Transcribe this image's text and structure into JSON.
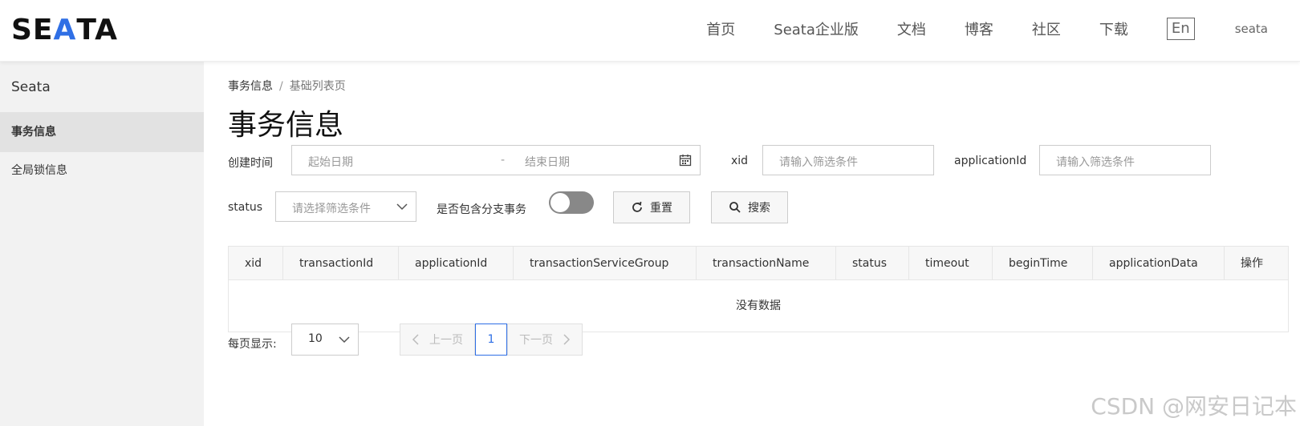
{
  "header": {
    "logo_pre": "SE",
    "logo_accent": "A",
    "logo_post": "TA",
    "nav": [
      "首页",
      "Seata企业版",
      "文档",
      "博客",
      "社区",
      "下载"
    ],
    "lang": "En",
    "user": "seata"
  },
  "sidebar": {
    "title": "Seata",
    "items": [
      {
        "label": "事务信息",
        "active": true
      },
      {
        "label": "全局锁信息",
        "active": false
      }
    ]
  },
  "breadcrumb": {
    "parent": "事务信息",
    "sep": "/",
    "current": "基础列表页"
  },
  "page_title": "事务信息",
  "filters": {
    "create_time_label": "创建时间",
    "start_placeholder": "起始日期",
    "range_sep": "-",
    "end_placeholder": "结束日期",
    "xid_label": "xid",
    "xid_placeholder": "请输入筛选条件",
    "app_label": "applicationId",
    "app_placeholder": "请输入筛选条件",
    "status_label": "status",
    "status_placeholder": "请选择筛选条件",
    "branch_label": "是否包含分支事务",
    "branch_on": false,
    "reset_label": "重置",
    "search_label": "搜索"
  },
  "table": {
    "columns": [
      "xid",
      "transactionId",
      "applicationId",
      "transactionServiceGroup",
      "transactionName",
      "status",
      "timeout",
      "beginTime",
      "applicationData",
      "操作"
    ],
    "empty_text": "没有数据"
  },
  "pagination": {
    "page_size_label": "每页显示:",
    "page_size": "10",
    "prev_label": "上一页",
    "current_page": "1",
    "next_label": "下一页"
  },
  "watermark": "CSDN @网安日记本",
  "colors": {
    "accent": "#2f6fe5",
    "sidebar_bg": "#f2f2f2",
    "active_bg": "#e2e2e2",
    "toggle_off": "#888888"
  }
}
